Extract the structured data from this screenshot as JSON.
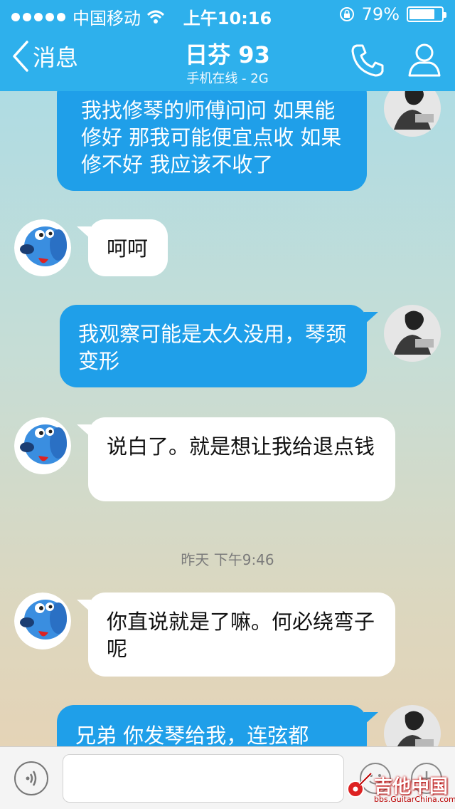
{
  "status_bar": {
    "carrier": "中国移动",
    "time": "上午10:16",
    "battery": "79%",
    "battery_level": 0.79
  },
  "nav": {
    "back_label": "消息",
    "title": "日芬 93",
    "subtitle": "手机在线 - 2G"
  },
  "messages": [
    {
      "direction": "outgoing",
      "text": "我找修琴的师傅问问 如果能修好 那我可能便宜点收 如果修不好 我应该不收了"
    },
    {
      "direction": "incoming",
      "text": "呵呵"
    },
    {
      "direction": "outgoing",
      "text": "我观察可能是太久没用，琴颈变形"
    },
    {
      "direction": "incoming",
      "text": "说白了。就是想让我给退点钱"
    },
    {
      "direction": "incoming",
      "text": "你直说就是了嘛。何必绕弯子呢"
    },
    {
      "direction": "outgoing",
      "text": "兄弟 你发琴给我，连弦都"
    }
  ],
  "timestamp": "昨天 下午9:46",
  "input": {
    "placeholder": ""
  },
  "watermark": {
    "title": "吉他中国",
    "url": "bbs.GuitarChina.com"
  },
  "colors": {
    "header": "#2eb0ec",
    "outgoing_bubble": "#1f9fe9",
    "incoming_bubble": "#ffffff"
  }
}
